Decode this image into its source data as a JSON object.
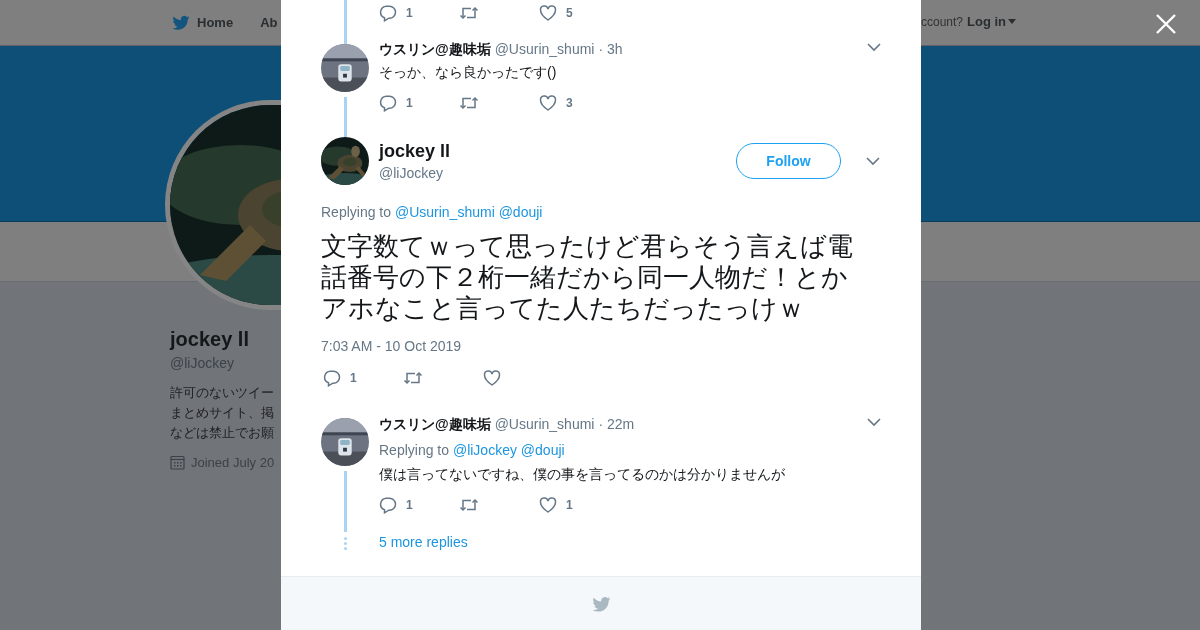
{
  "nav": {
    "items": [
      {
        "label": "Home"
      },
      {
        "label": "Ab"
      }
    ],
    "account_prompt": "ccount?",
    "login": "Log in"
  },
  "profile": {
    "name": "jockey ll",
    "handle": "@liJockey",
    "bio": [
      "許可のないツイー",
      "まとめサイト、掲",
      "などは禁止でお願"
    ],
    "joined": "Joined July 20"
  },
  "thread": [
    {
      "kind": "actions_only",
      "actions": [
        {
          "kind": "reply",
          "count": "1"
        },
        {
          "kind": "retweet"
        },
        {
          "kind": "like",
          "count": "5"
        }
      ]
    },
    {
      "kind": "reply",
      "name": "ウスリン@趣味垢",
      "handle": "@Usurin_shumi",
      "time": "· 3h",
      "text": "そっか、なら良かったです()",
      "actions": [
        {
          "kind": "reply",
          "count": "1"
        },
        {
          "kind": "retweet"
        },
        {
          "kind": "like",
          "count": "3"
        }
      ]
    },
    {
      "kind": "focus",
      "name": "jockey ll",
      "handle": "@liJockey",
      "follow_label": "Follow",
      "replying_prefix": "Replying to",
      "mentions": [
        "@Usurin_shumi",
        "@douji"
      ],
      "text": "文字数てｗって思ったけど君らそう言えば電話番号の下２桁一緒だから同一人物だ！とかアホなこと言ってた人たちだったっけｗ",
      "timestamp": "7:03 AM - 10 Oct 2019",
      "actions": [
        {
          "kind": "reply",
          "count": "1"
        },
        {
          "kind": "retweet"
        },
        {
          "kind": "like"
        }
      ]
    },
    {
      "kind": "reply",
      "name": "ウスリン@趣味垢",
      "handle": "@Usurin_shumi",
      "time": "· 22m",
      "replying_prefix": "Replying to",
      "mentions": [
        "@liJockey",
        "@douji"
      ],
      "text": "僕は言ってないですね、僕の事を言ってるのかは分かりませんが",
      "actions": [
        {
          "kind": "reply",
          "count": "1"
        },
        {
          "kind": "retweet"
        },
        {
          "kind": "like",
          "count": "1"
        }
      ],
      "more_replies": "5 more replies"
    }
  ]
}
